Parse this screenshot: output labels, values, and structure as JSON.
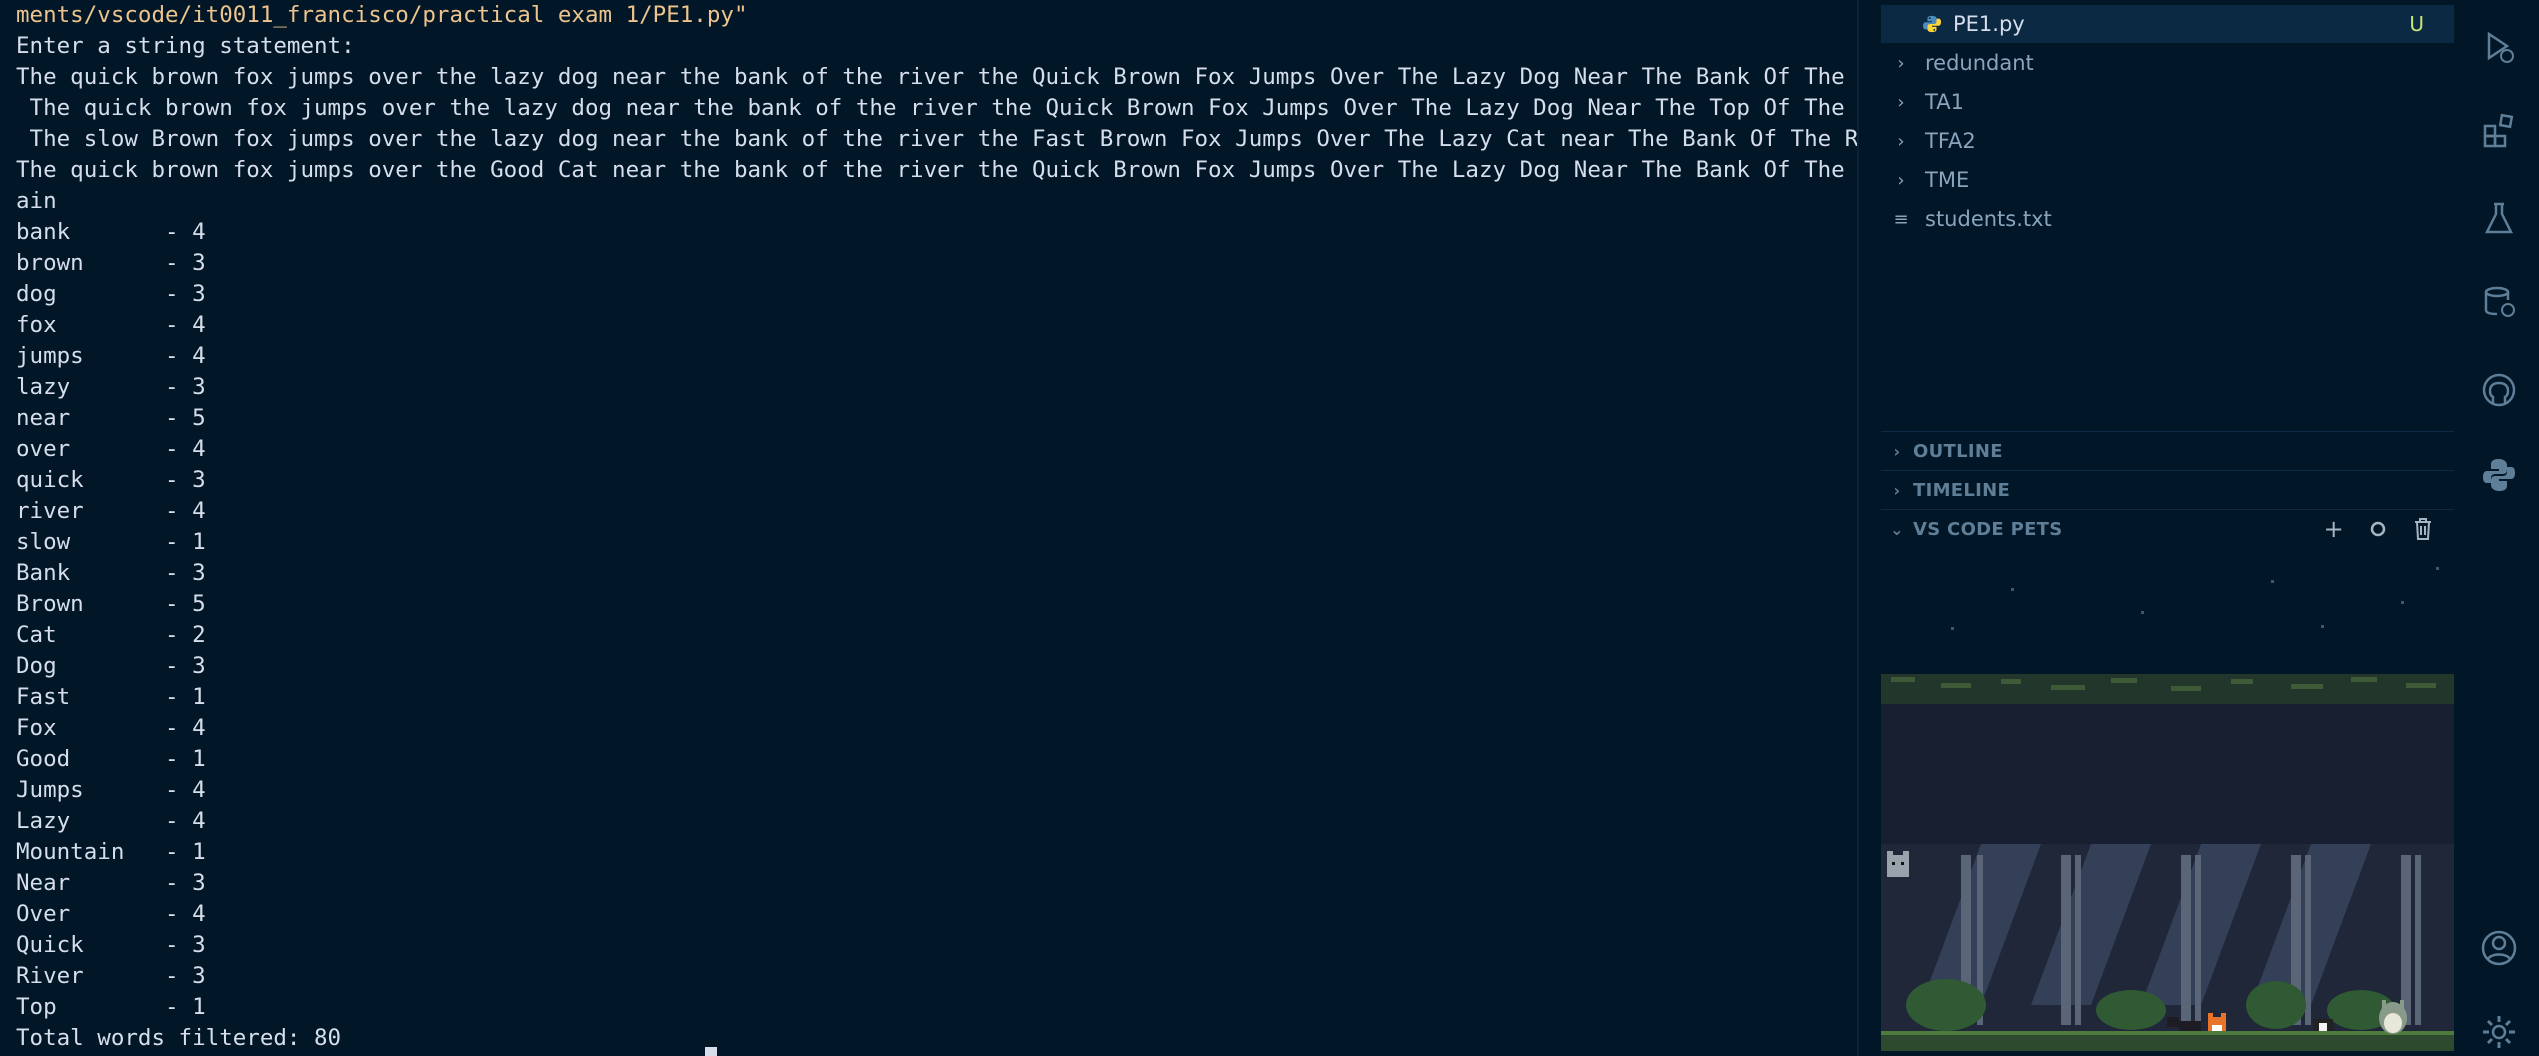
{
  "terminal": {
    "lines": [
      "ments/vscode/it0011_francisco/practical exam 1/PE1.py\"",
      "Enter a string statement:",
      "The quick brown fox jumps over the lazy dog near the bank of the river the Quick Brown Fox Jumps Over The Lazy Dog Near The Bank Of The River",
      " The quick brown fox jumps over the lazy dog near the bank of the river the Quick Brown Fox Jumps Over The Lazy Dog Near The Top Of The River",
      " The slow Brown fox jumps over the lazy dog near the bank of the river the Fast Brown Fox Jumps Over The Lazy Cat near The Bank Of The River",
      "The quick brown fox jumps over the Good Cat near the bank of the river the Quick Brown Fox Jumps Over The Lazy Dog Near The Bank Of The Mount",
      "ain",
      "bank       - 4",
      "brown      - 3",
      "dog        - 3",
      "fox        - 4",
      "jumps      - 4",
      "lazy       - 3",
      "near       - 5",
      "over       - 4",
      "quick      - 3",
      "river      - 4",
      "slow       - 1",
      "Bank       - 3",
      "Brown      - 5",
      "Cat        - 2",
      "Dog        - 3",
      "Fast       - 1",
      "Fox        - 4",
      "Good       - 1",
      "Jumps      - 4",
      "Lazy       - 4",
      "Mountain   - 1",
      "Near       - 3",
      "Over       - 4",
      "Quick      - 3",
      "River      - 3",
      "Top        - 1",
      "Total words filtered: 80"
    ]
  },
  "explorer": {
    "active_file": {
      "name": "PE1.py",
      "status": "U",
      "icon": "python-file-icon"
    },
    "folders": [
      "redundant",
      "TA1",
      "TFA2",
      "TME"
    ],
    "files": [
      {
        "name": "students.txt",
        "icon": "text-file-icon"
      }
    ]
  },
  "sections": {
    "outline": "OUTLINE",
    "timeline": "TIMELINE",
    "pets": "VS CODE PETS"
  },
  "pets_actions": [
    "add-icon",
    "ball-icon",
    "trash-icon"
  ],
  "activity_icons": [
    "run-debug-icon",
    "extensions-icon",
    "testing-icon",
    "database-icon",
    "github-icon",
    "python-icon",
    "account-icon",
    "settings-gear-icon"
  ],
  "colors": {
    "background": "#011627",
    "text": "#d6deeb",
    "path_text": "#ecc48d",
    "untracked_badge": "#c5e478",
    "selection": "#0b2942"
  }
}
